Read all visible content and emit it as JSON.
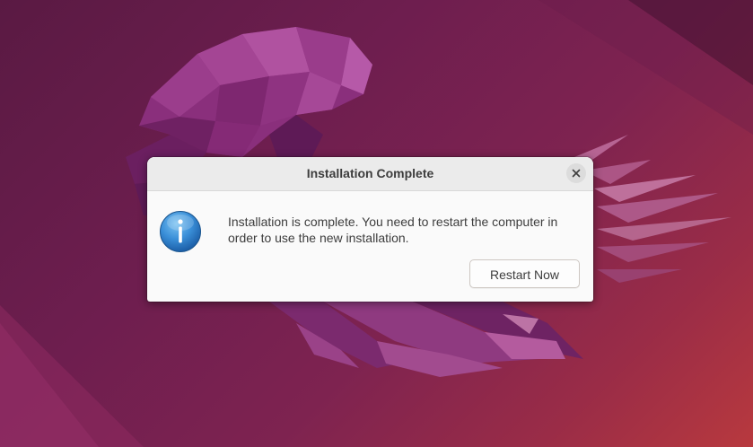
{
  "dialog": {
    "title": "Installation Complete",
    "message": "Installation is complete. You need to restart the computer in order to use the new installation.",
    "close_icon": "close-icon",
    "info_icon": "info-icon",
    "primary_button_label": "Restart Now"
  },
  "wallpaper": {
    "background_colors": [
      "#5a1a43",
      "#7e2350",
      "#b8393e"
    ],
    "accent_color": "#9c3b8d"
  }
}
